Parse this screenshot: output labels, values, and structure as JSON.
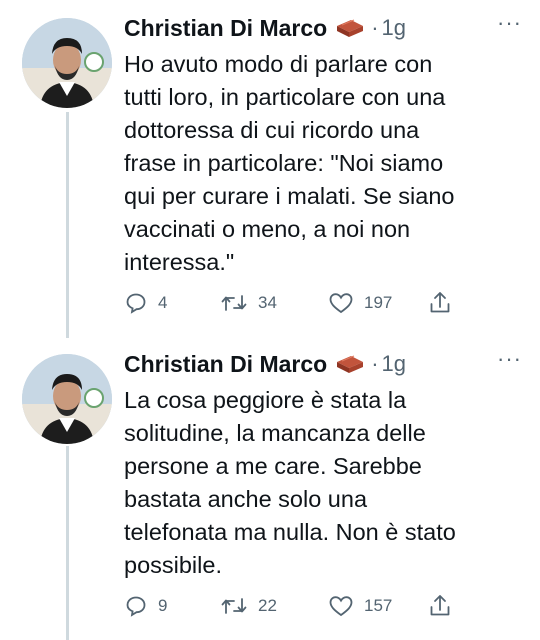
{
  "tweets": [
    {
      "author": "Christian Di Marco",
      "badge": "brick-emoji",
      "separator": "·",
      "time": "1g",
      "more": "···",
      "text": "Ho avuto modo di parlare con\ntutti loro, in particolare con una\ndottoressa di cui ricordo una\nfrase in particolare: \"Noi siamo\nqui per curare i malati. Se siano\nvaccinati o meno, a noi non\ninteressa.\"",
      "replies": "4",
      "retweets": "34",
      "likes": "197"
    },
    {
      "author": "Christian Di Marco",
      "badge": "brick-emoji",
      "separator": "·",
      "time": "1g",
      "more": "···",
      "text": "La cosa peggiore è stata la\nsolitudine, la mancanza delle\npersone a me care. Sarebbe\nbastata anche solo una\ntelefonata ma nulla. Non è stato\npossibile.",
      "replies": "9",
      "retweets": "22",
      "likes": "157"
    }
  ],
  "colors": {
    "text": "#0f1419",
    "secondary": "#536471",
    "thread_line": "#cfd9de"
  },
  "icons": [
    "reply-icon",
    "retweet-icon",
    "like-icon",
    "share-icon",
    "more-icon"
  ]
}
